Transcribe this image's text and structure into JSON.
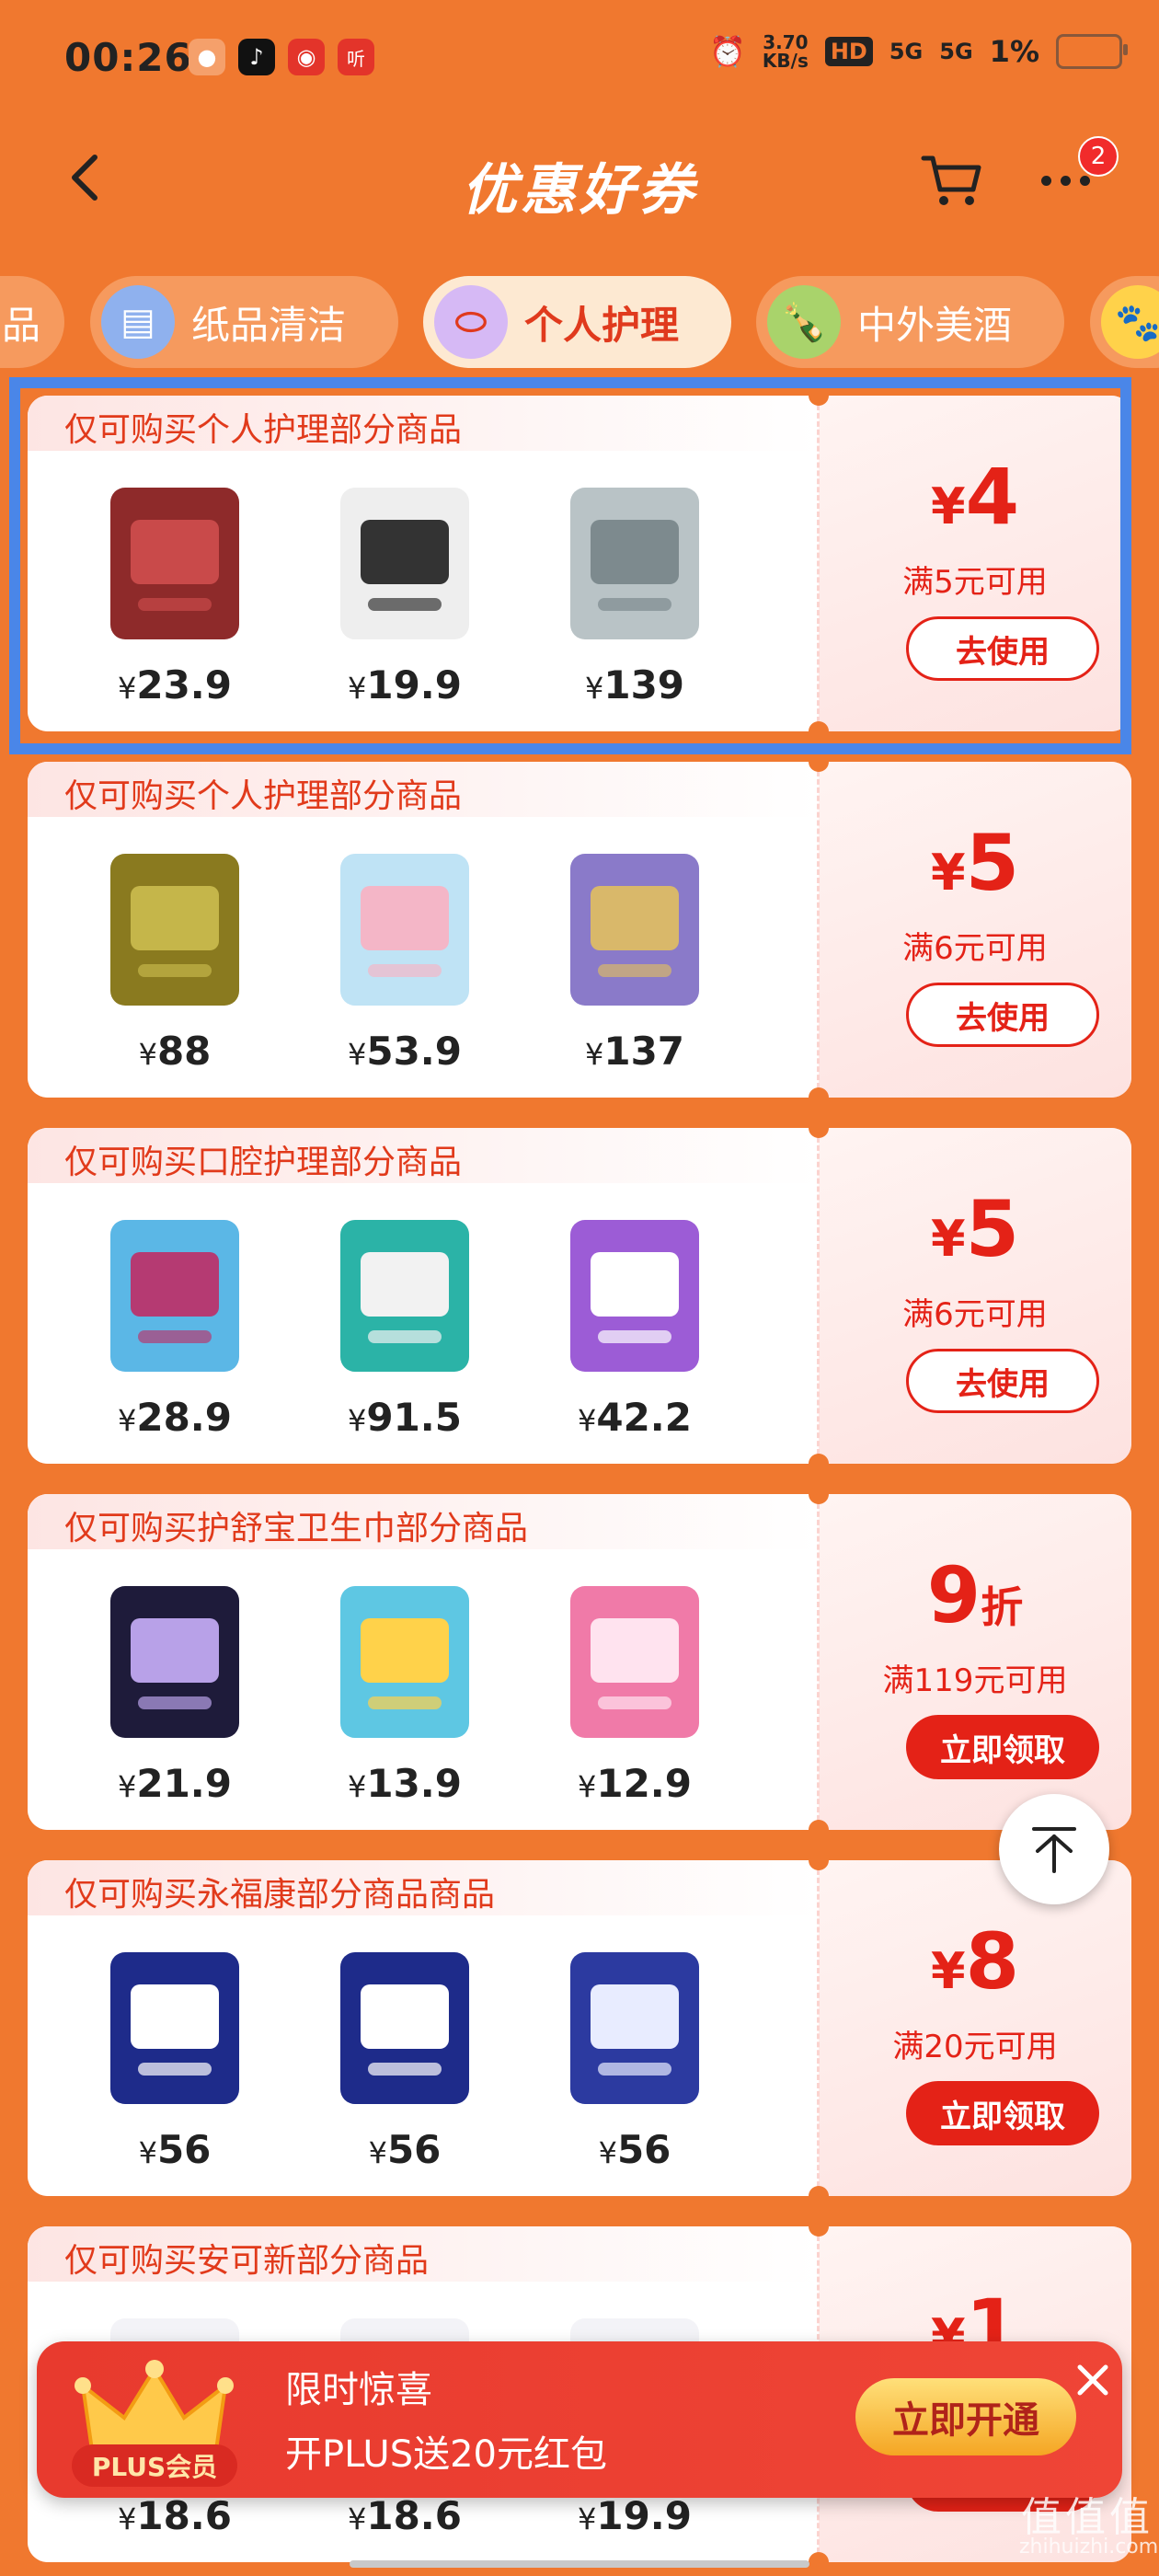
{
  "status_bar": {
    "time": "00:26",
    "app_icons": [
      "zhihu-bird-icon",
      "tiktok-icon",
      "netease-music-icon",
      "ting-icon"
    ],
    "net_speed_top": "3.70",
    "net_speed_unit": "KB/s",
    "hd_label": "HD",
    "signal_1": "5G",
    "signal_2": "5G",
    "battery": "1%"
  },
  "nav": {
    "title": "优惠好券",
    "badge_count": "2"
  },
  "tabs": [
    {
      "label": "品",
      "icon": "partial-icon",
      "active": false
    },
    {
      "label": "纸品清洁",
      "icon": "tissue-icon",
      "active": false
    },
    {
      "label": "个人护理",
      "icon": "lotion-icon",
      "active": true
    },
    {
      "label": "中外美酒",
      "icon": "wine-icon",
      "active": false
    }
  ],
  "coupons": [
    {
      "condition": "仅可购买个人护理部分商品",
      "products": [
        {
          "price": "23.9",
          "icon": "soap-icon"
        },
        {
          "price": "19.9",
          "icon": "toothbrush-icon"
        },
        {
          "price": "139",
          "icon": "bottle-icon"
        }
      ],
      "amount": "4",
      "unit": "",
      "threshold": "满5元可用",
      "button": "去使用",
      "button_style": "outline"
    },
    {
      "condition": "仅可购买个人护理部分商品",
      "products": [
        {
          "price": "88",
          "icon": "shampoo-icon"
        },
        {
          "price": "53.9",
          "icon": "clear-shampoo-icon"
        },
        {
          "price": "137",
          "icon": "loreal-set-icon"
        }
      ],
      "amount": "5",
      "unit": "",
      "threshold": "满6元可用",
      "button": "去使用",
      "button_style": "outline"
    },
    {
      "condition": "仅可购买口腔护理部分商品",
      "products": [
        {
          "price": "28.9",
          "icon": "interdental-brush-icon"
        },
        {
          "price": "91.5",
          "icon": "toothpaste-set-icon"
        },
        {
          "price": "42.2",
          "icon": "toothpaste-icon"
        }
      ],
      "amount": "5",
      "unit": "",
      "threshold": "满6元可用",
      "button": "去使用",
      "button_style": "outline"
    },
    {
      "condition": "仅可购买护舒宝卫生巾部分商品",
      "products": [
        {
          "price": "21.9",
          "icon": "pad-pack-icon"
        },
        {
          "price": "13.9",
          "icon": "cotton-pad-icon"
        },
        {
          "price": "12.9",
          "icon": "liner-icon"
        }
      ],
      "amount": "9",
      "unit": "折",
      "threshold": "满119元可用",
      "button": "立即领取",
      "button_style": "solid"
    },
    {
      "condition": "仅可购买永福康部分商品商品",
      "products": [
        {
          "price": "56",
          "icon": "diaper-m-icon"
        },
        {
          "price": "56",
          "icon": "diaper-xl-icon"
        },
        {
          "price": "56",
          "icon": "diaper-l-icon"
        }
      ],
      "amount": "8",
      "unit": "",
      "threshold": "满20元可用",
      "button": "立即领取",
      "button_style": "solid"
    },
    {
      "condition": "仅可购买安可新部分商品",
      "products": [
        {
          "price": "18.6",
          "icon": "box-icon"
        },
        {
          "price": "18.6",
          "icon": "box-icon"
        },
        {
          "price": "19.9",
          "icon": "box-icon"
        }
      ],
      "amount": "1",
      "unit": "",
      "threshold": "",
      "button": "立即领取",
      "button_style": "solid"
    }
  ],
  "plus_banner": {
    "badge": "PLUS会员",
    "line1": "限时惊喜",
    "line2": "开PLUS送20元红包",
    "button": "立即开通"
  },
  "watermark": {
    "logo": "值值值",
    "site": "zhihuizhi.com"
  },
  "currency": "¥",
  "colors": {
    "accent": "#e42217",
    "background": "#f0782f",
    "selection": "#4a86e8"
  }
}
